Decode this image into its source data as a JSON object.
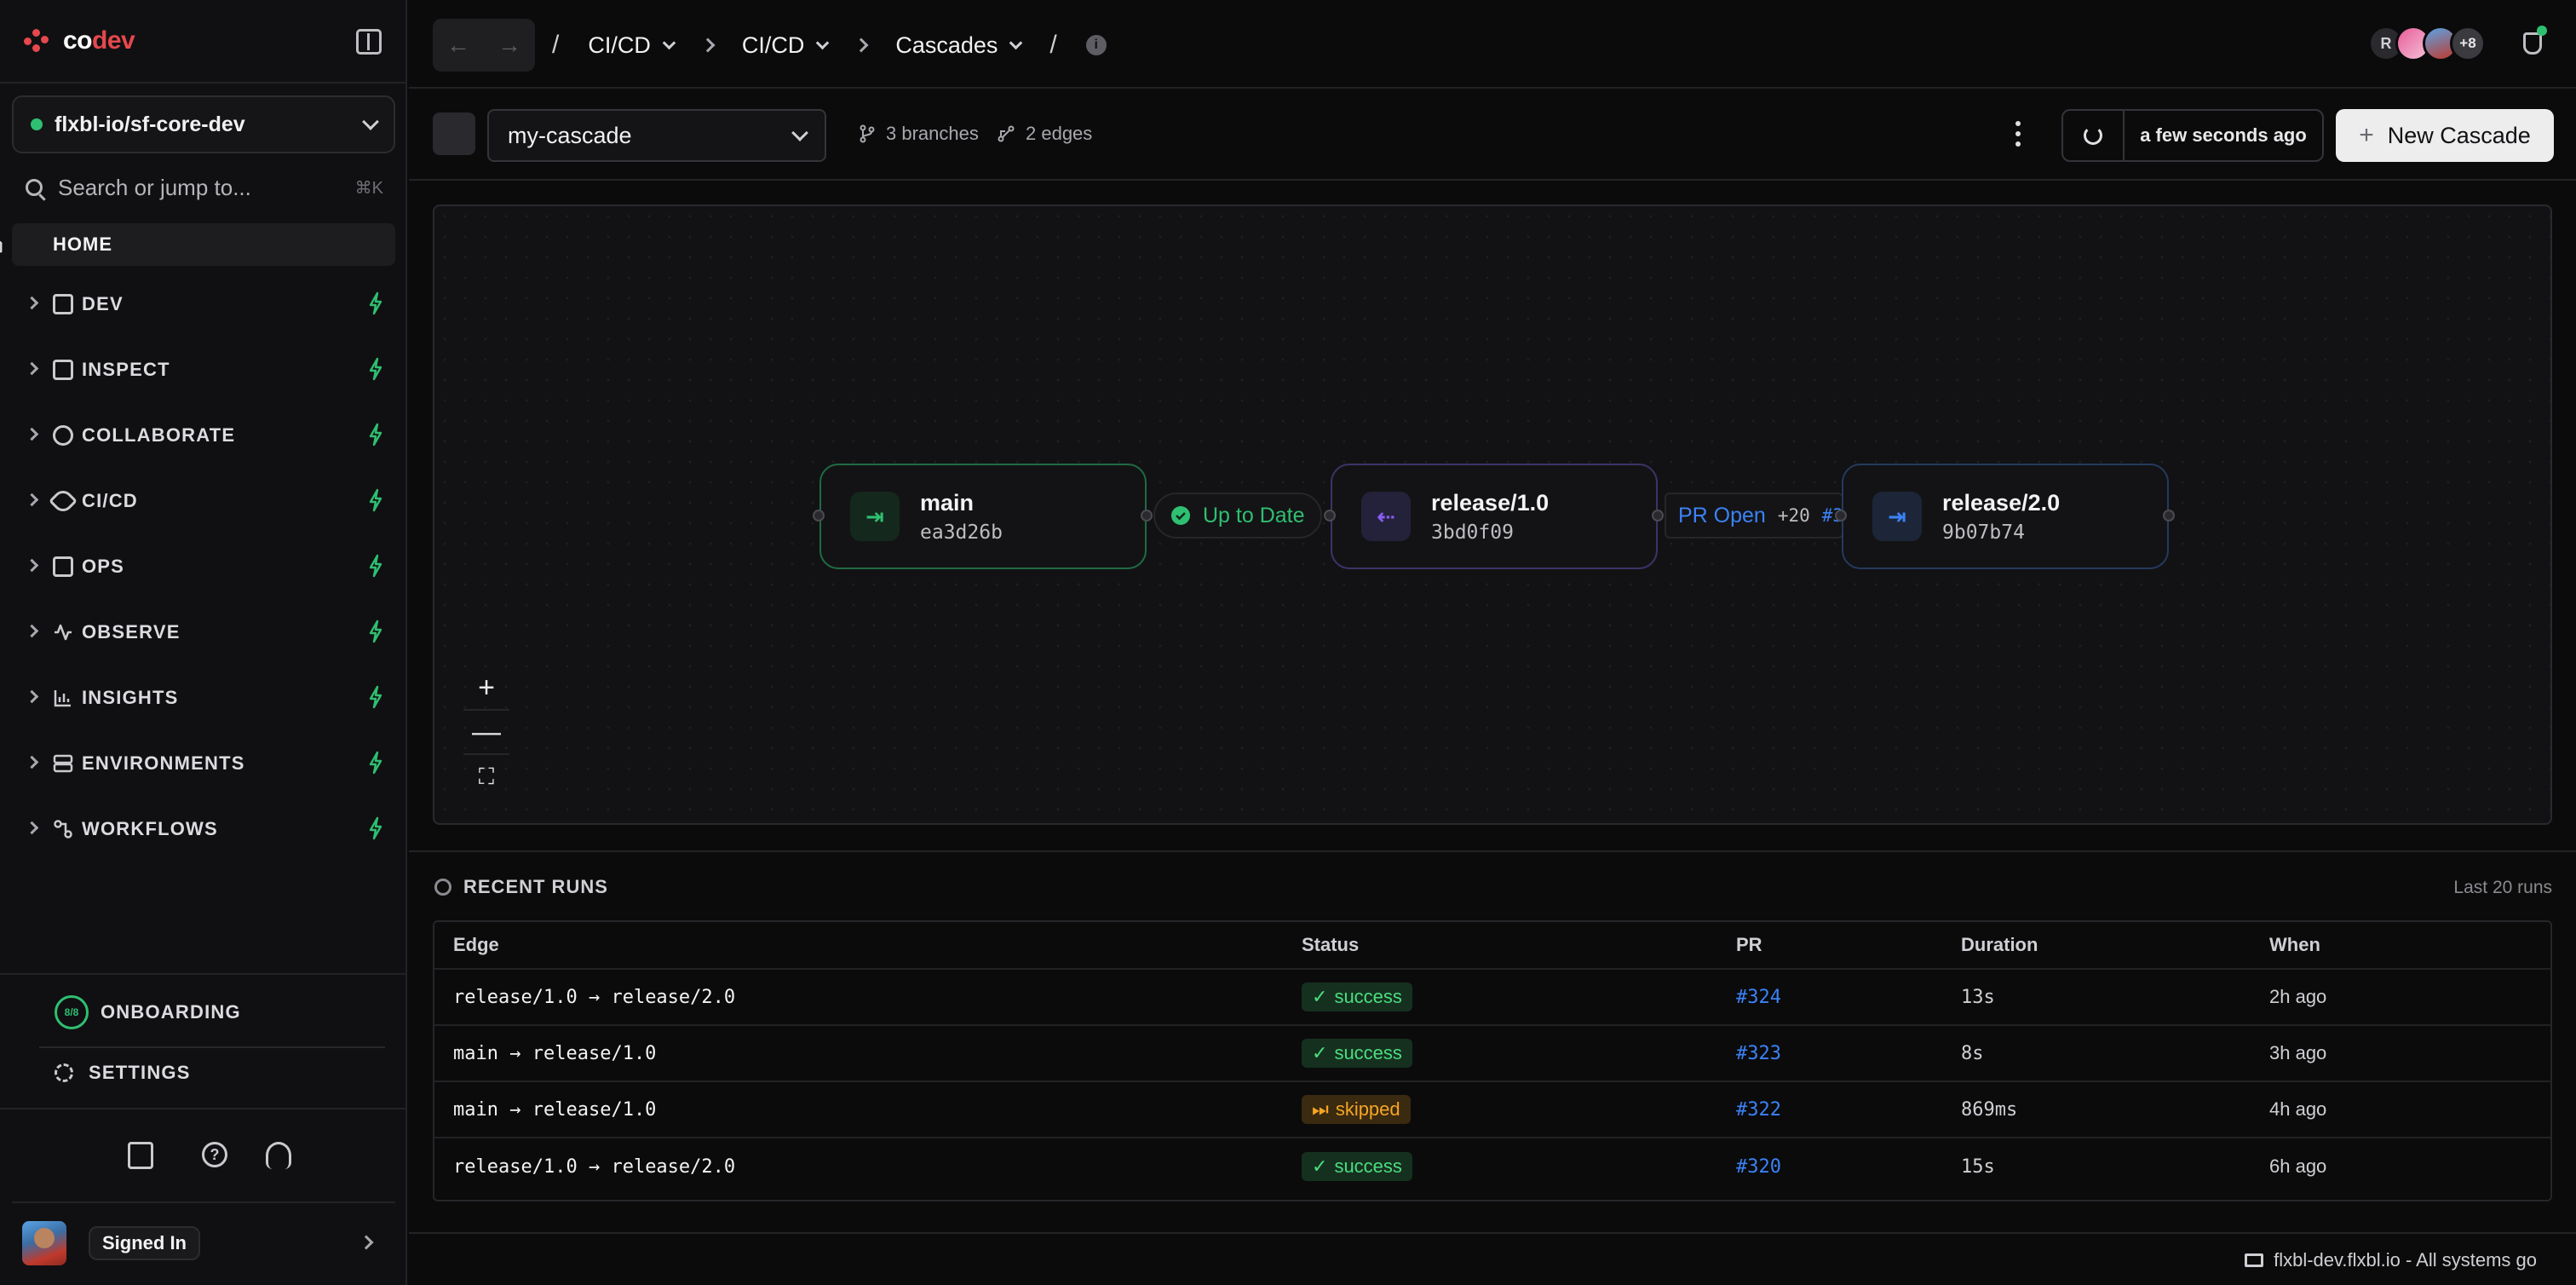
{
  "app": {
    "name_co": "co",
    "name_dev": "dev",
    "accent": "#e5484d"
  },
  "sidebar": {
    "repo": "flxbl-io/sf-core-dev",
    "search_label": "Search or jump to...",
    "search_shortcut": "⌘K",
    "home": "HOME",
    "items": [
      {
        "label": "DEV",
        "icon": "code-icon"
      },
      {
        "label": "INSPECT",
        "icon": "flask-icon"
      },
      {
        "label": "COLLABORATE",
        "icon": "users-icon"
      },
      {
        "label": "CI/CD",
        "icon": "rocket-icon"
      },
      {
        "label": "OPS",
        "icon": "clipboard-icon"
      },
      {
        "label": "OBSERVE",
        "icon": "activity-icon"
      },
      {
        "label": "INSIGHTS",
        "icon": "bar-chart-icon"
      },
      {
        "label": "ENVIRONMENTS",
        "icon": "server-icon"
      },
      {
        "label": "WORKFLOWS",
        "icon": "workflow-icon"
      }
    ],
    "onboarding": {
      "label": "ONBOARDING",
      "progress": "8/8"
    },
    "settings": "SETTINGS",
    "user_status": "Signed In"
  },
  "header": {
    "breadcrumbs": [
      "CI/CD",
      "CI/CD",
      "Cascades"
    ],
    "avatar_initial": "R",
    "avatar_overflow": "+8",
    "status_color": "#2fbf71"
  },
  "toolbar": {
    "cascade": "my-cascade",
    "branches": "3 branches",
    "edges": "2 edges",
    "refreshed": "a few seconds ago",
    "new_button": "New Cascade"
  },
  "graph": {
    "nodes": [
      {
        "name": "main",
        "sha": "ea3d26b",
        "color": "#2fbf71"
      },
      {
        "name": "release/1.0",
        "sha": "3bd0f09",
        "color": "#8b5cf6"
      },
      {
        "name": "release/2.0",
        "sha": "9b07b74",
        "color": "#3b82f6"
      }
    ],
    "edges": [
      {
        "status": "Up to Date",
        "color": "#2fbf71"
      },
      {
        "status": "PR Open",
        "diff": "+20",
        "pr": "#3",
        "color": "#3b82f6"
      }
    ]
  },
  "runs": {
    "title": "RECENT RUNS",
    "count_label": "Last 20 runs",
    "columns": [
      "Edge",
      "Status",
      "PR",
      "Duration",
      "When"
    ],
    "rows": [
      {
        "from": "release/1.0",
        "to": "release/2.0",
        "status": "success",
        "pr": "#324",
        "duration": "13s",
        "when": "2h ago"
      },
      {
        "from": "main",
        "to": "release/1.0",
        "status": "success",
        "pr": "#323",
        "duration": "8s",
        "when": "3h ago"
      },
      {
        "from": "main",
        "to": "release/1.0",
        "status": "skipped",
        "pr": "#322",
        "duration": "869ms",
        "when": "4h ago"
      },
      {
        "from": "release/1.0",
        "to": "release/2.0",
        "status": "success",
        "pr": "#320",
        "duration": "15s",
        "when": "6h ago"
      }
    ]
  },
  "footer": {
    "status": "flxbl-dev.flxbl.io - All systems go"
  }
}
